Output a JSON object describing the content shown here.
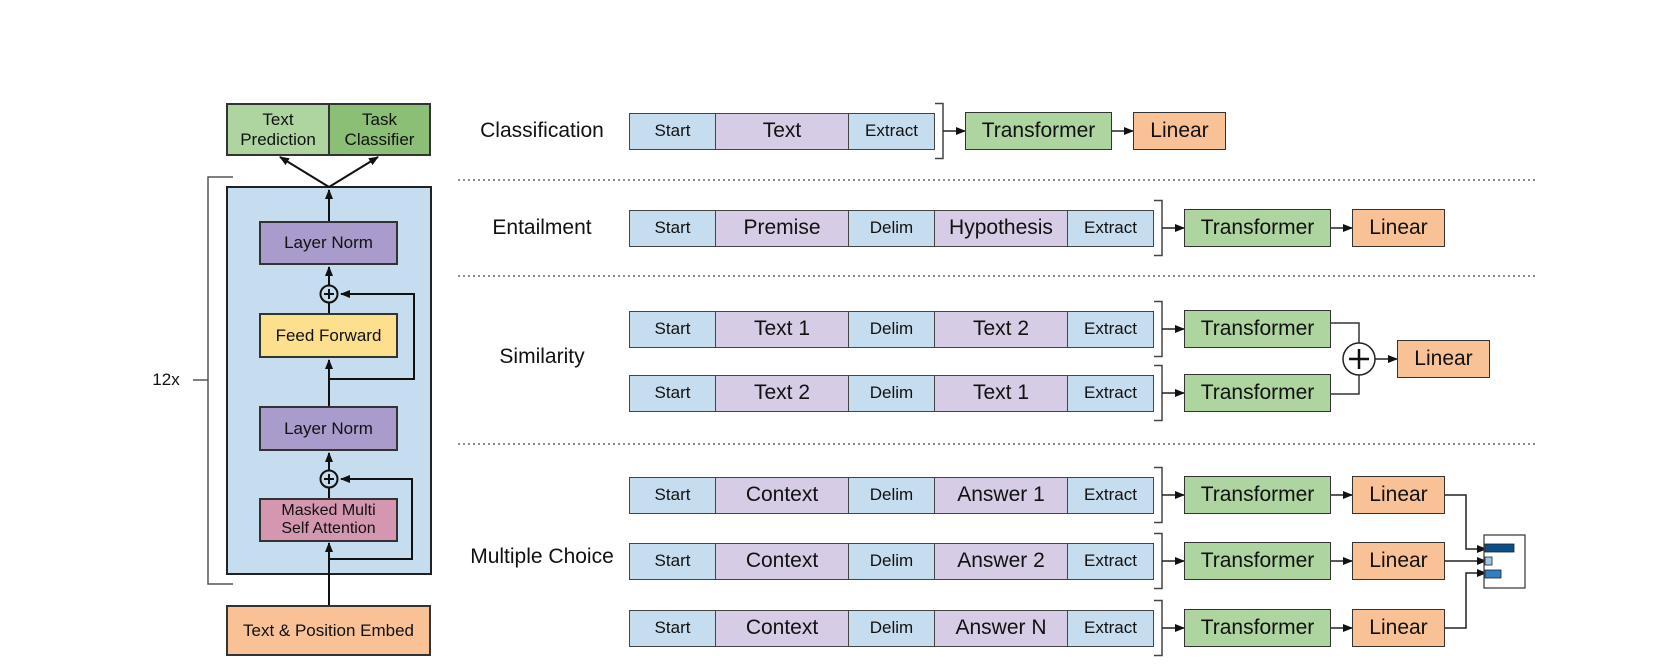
{
  "architecture": {
    "repeat_label": "12x",
    "outputs": [
      {
        "label_line1": "Text",
        "label_line2": "Prediction"
      },
      {
        "label_line1": "Task",
        "label_line2": "Classifier"
      }
    ],
    "blocks": {
      "layer_norm_top": "Layer Norm",
      "feed_forward": "Feed Forward",
      "layer_norm_bottom": "Layer Norm",
      "attention_line1": "Masked Multi",
      "attention_line2": "Self Attention"
    },
    "embed": "Text & Position Embed"
  },
  "tasks": [
    {
      "name": "Classification",
      "rows": [
        {
          "tokens": [
            "Start",
            "Text",
            "Extract"
          ],
          "model": "Transformer",
          "head": "Linear"
        }
      ]
    },
    {
      "name": "Entailment",
      "rows": [
        {
          "tokens": [
            "Start",
            "Premise",
            "Delim",
            "Hypothesis",
            "Extract"
          ],
          "model": "Transformer",
          "head": "Linear"
        }
      ]
    },
    {
      "name": "Similarity",
      "rows": [
        {
          "tokens": [
            "Start",
            "Text 1",
            "Delim",
            "Text 2",
            "Extract"
          ],
          "model": "Transformer"
        },
        {
          "tokens": [
            "Start",
            "Text 2",
            "Delim",
            "Text 1",
            "Extract"
          ],
          "model": "Transformer"
        }
      ],
      "combine_symbol": "+",
      "head": "Linear"
    },
    {
      "name": "Multiple Choice",
      "rows": [
        {
          "tokens": [
            "Start",
            "Context",
            "Delim",
            "Answer 1",
            "Extract"
          ],
          "model": "Transformer",
          "head": "Linear"
        },
        {
          "tokens": [
            "Start",
            "Context",
            "Delim",
            "Answer 2",
            "Extract"
          ],
          "model": "Transformer",
          "head": "Linear"
        },
        {
          "tokens": [
            "Start",
            "Context",
            "Delim",
            "Answer N",
            "Extract"
          ],
          "model": "Transformer",
          "head": "Linear"
        }
      ]
    }
  ],
  "colors": {
    "token_special": "#c6dcef",
    "token_text": "#d6cce6",
    "transformer": "#aed4a0",
    "linear": "#f9c196",
    "text_prediction": "#aed4a0",
    "task_classifier": "#8bbf76",
    "stack_bg": "#c6dcef",
    "layer_norm": "#a99bcc",
    "feed_forward": "#fde08e",
    "attention": "#d597b0",
    "embed": "#f9c196",
    "softmax_bars": [
      "#0b4f8a",
      "#9ec6e8",
      "#2f7fc1"
    ]
  }
}
